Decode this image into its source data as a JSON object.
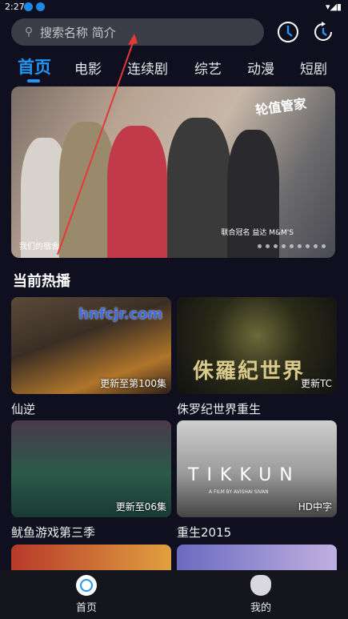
{
  "status": {
    "time": "2:27",
    "right_icons": "▾◢▮"
  },
  "search": {
    "placeholder": "搜索名称 简介",
    "icon": "search-icon"
  },
  "header_icons": [
    "history-icon",
    "refresh-icon"
  ],
  "tabs": [
    {
      "label": "首页",
      "active": true
    },
    {
      "label": "电影"
    },
    {
      "label": "连续剧"
    },
    {
      "label": "综艺"
    },
    {
      "label": "动漫"
    },
    {
      "label": "短剧"
    }
  ],
  "banner": {
    "caption": "我们的宿舍",
    "logo_text": "轮值管家",
    "brand_text": "联合冠名 益达 M&M'S",
    "dot_count": 9
  },
  "section": {
    "title": "当前热播"
  },
  "watermark": "hnfcjr.com",
  "cards": [
    {
      "name": "仙逆",
      "badge": "更新至第100集"
    },
    {
      "name": "侏罗纪世界重生",
      "badge": "更新TC"
    },
    {
      "name": "鱿鱼游戏第三季",
      "badge": "更新至06集"
    },
    {
      "name": "重生2015",
      "badge": "HD中字"
    }
  ],
  "card_overlays": {
    "jurassic_title": "侏羅紀世界",
    "tikkun_title": "TIKKUN",
    "tikkun_sub": "A FILM BY AVISHAI SIVAN"
  },
  "nav": [
    {
      "label": "首页",
      "active": true
    },
    {
      "label": "我的"
    }
  ]
}
